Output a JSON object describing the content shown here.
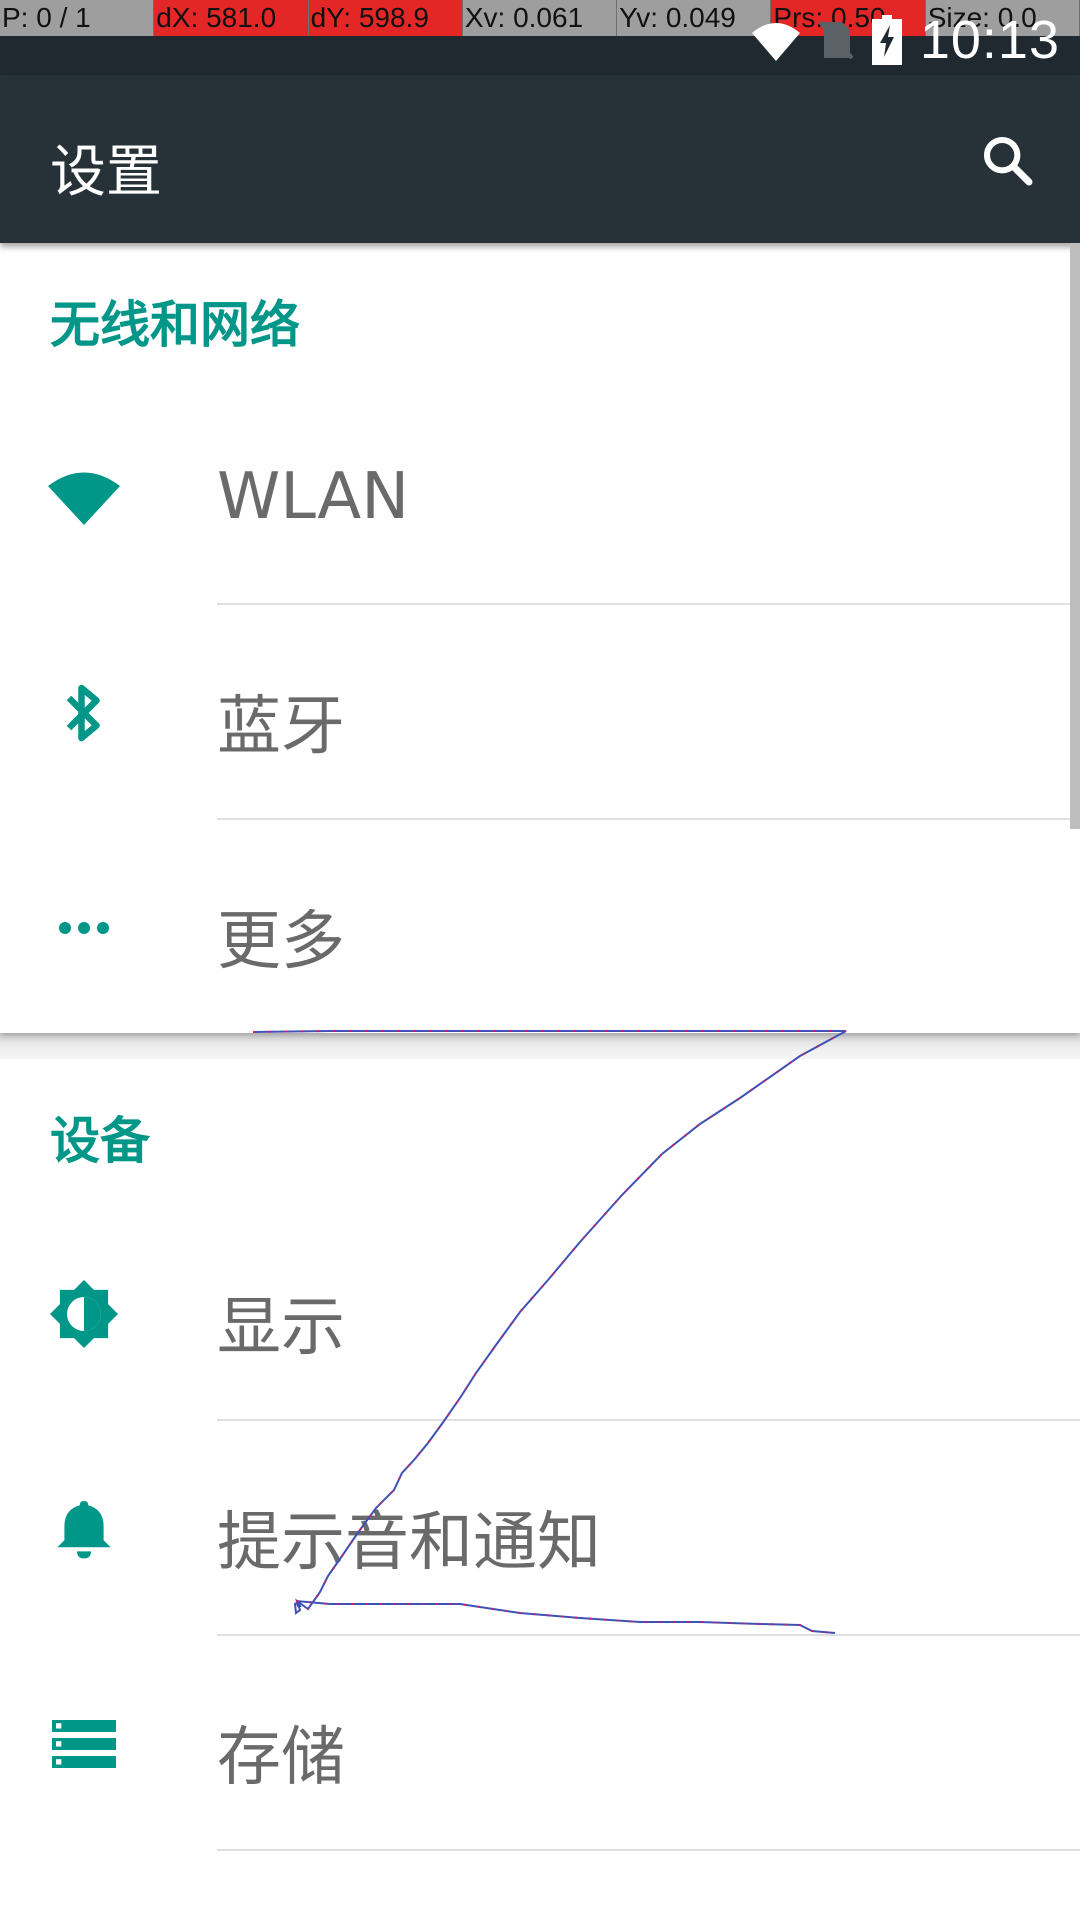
{
  "pointer_location": {
    "cells": [
      {
        "text": "P: 0 / 1",
        "highlight": false
      },
      {
        "text": "dX: 581.0",
        "highlight": true
      },
      {
        "text": "dY: 598.9",
        "highlight": true
      },
      {
        "text": "Xv: 0.061",
        "highlight": false
      },
      {
        "text": "Yv: 0.049",
        "highlight": false
      },
      {
        "text": "Prs: 0.50",
        "highlight": true
      },
      {
        "text": "Size: 0.0",
        "highlight": false
      }
    ]
  },
  "status_bar": {
    "time": "10:13",
    "icons": [
      "wifi-icon",
      "no-sim-icon",
      "battery-charging-icon"
    ]
  },
  "app_bar": {
    "title": "设置",
    "search_icon": "search-icon"
  },
  "sections": [
    {
      "header": "无线和网络",
      "items": [
        {
          "label": "WLAN",
          "icon": "wifi-icon"
        },
        {
          "label": "蓝牙",
          "icon": "bluetooth-icon"
        },
        {
          "label": "更多",
          "icon": "more-horiz-icon"
        }
      ]
    },
    {
      "header": "设备",
      "items": [
        {
          "label": "显示",
          "icon": "brightness-icon"
        },
        {
          "label": "提示音和通知",
          "icon": "bell-icon"
        },
        {
          "label": "存储",
          "icon": "storage-icon"
        }
      ]
    }
  ],
  "colors": {
    "accent": "#009688",
    "app_bar": "#263238",
    "status_bar": "#202830",
    "highlight": "#e32626",
    "trace_line": "#3f51b5",
    "trace_points": "#d81b60"
  }
}
